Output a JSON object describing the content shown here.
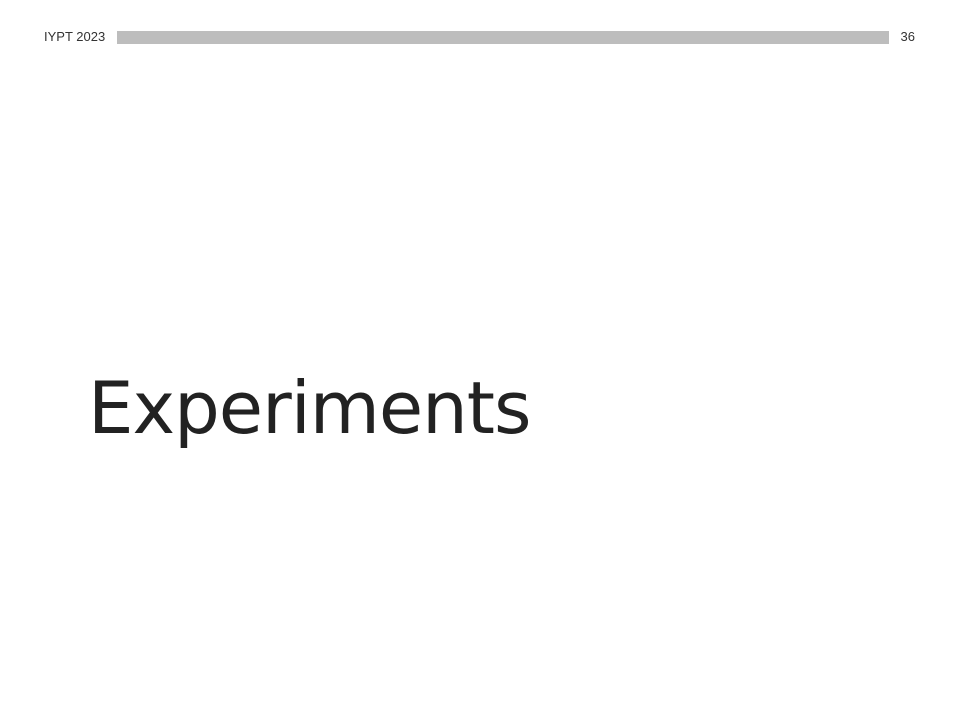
{
  "header": {
    "event_label": "IYPT 2023",
    "page_number": "36"
  },
  "slide": {
    "title": "Experiments"
  },
  "colors": {
    "background": "#ffffff",
    "header_bar": "#bdbdbd",
    "text": "#222222"
  }
}
